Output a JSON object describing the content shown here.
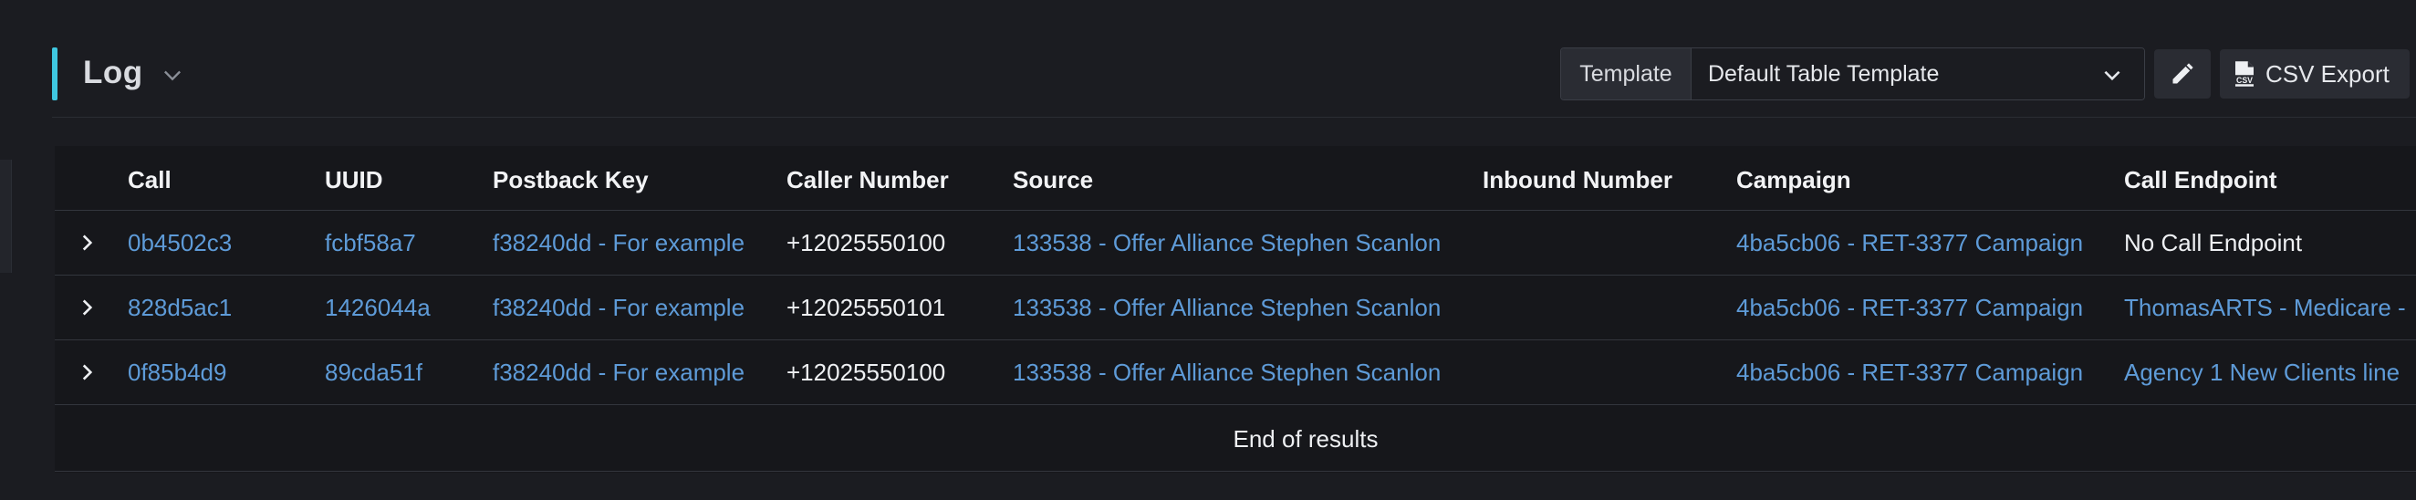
{
  "header": {
    "title": "Log",
    "template_label": "Template",
    "template_value": "Default Table Template",
    "csv_export_label": "CSV Export",
    "accent_color": "#3fc7e0"
  },
  "icons": {
    "title_dropdown": "chevron-down-icon",
    "template_dropdown": "chevron-down-icon",
    "edit": "pencil-icon",
    "csv": "csv-file-icon",
    "row_expand": "chevron-right-icon"
  },
  "table": {
    "columns": [
      "Call",
      "UUID",
      "Postback Key",
      "Caller Number",
      "Source",
      "Inbound Number",
      "Campaign",
      "Call Endpoint"
    ],
    "rows": [
      {
        "call": "0b4502c3",
        "uuid": "fcbf58a7",
        "postback_key": "f38240dd - For example",
        "caller_number": "+12025550100",
        "source": "133538 - Offer Alliance Stephen Scanlon",
        "inbound_number": "",
        "campaign": "4ba5cb06 - RET-3377 Campaign",
        "call_endpoint": "No Call Endpoint"
      },
      {
        "call": "828d5ac1",
        "uuid": "1426044a",
        "postback_key": "f38240dd - For example",
        "caller_number": "+12025550101",
        "source": "133538 - Offer Alliance Stephen Scanlon",
        "inbound_number": "",
        "campaign": "4ba5cb06 - RET-3377 Campaign",
        "call_endpoint": "ThomasARTS - Medicare -"
      },
      {
        "call": "0f85b4d9",
        "uuid": "89cda51f",
        "postback_key": "f38240dd - For example",
        "caller_number": "+12025550100",
        "source": "133538 - Offer Alliance Stephen Scanlon",
        "inbound_number": "",
        "campaign": "4ba5cb06 - RET-3377 Campaign",
        "call_endpoint": "Agency 1 New Clients line"
      }
    ],
    "end_text": "End of results"
  },
  "colors": {
    "background": "#1b1c21",
    "table_background": "#16171b",
    "link": "#5e9bd8",
    "text": "#eef0f3"
  }
}
